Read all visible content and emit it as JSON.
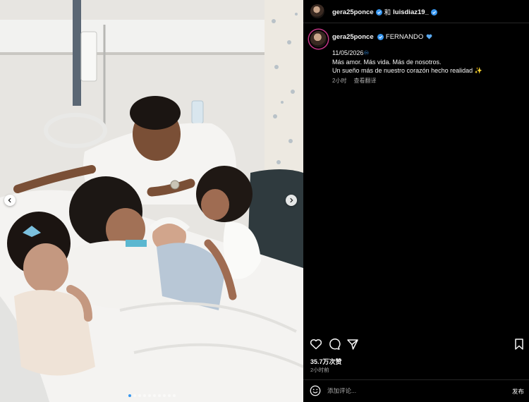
{
  "header": {
    "username": "gera25ponce",
    "connector": "和",
    "collaborator": "luisdiaz19_"
  },
  "caption": {
    "username": "gera25ponce",
    "name": "FERNANDO",
    "date": "11/05/2026",
    "line1": "Más amor. Más vida. Más de nosotros.",
    "line2": "Un sueño más de nuestro corazón hecho realidad",
    "time": "2小时",
    "translate": "查看翻译"
  },
  "post": {
    "likes": "35.7万次赞",
    "time": "2小时前"
  },
  "comment": {
    "placeholder": "添加评论...",
    "post_label": "发布"
  },
  "carousel": {
    "slides": 10,
    "active": 1
  },
  "colors": {
    "verified": "#3897f0",
    "heart": "#5aa9f0",
    "background": "#000000"
  },
  "icons": [
    "chevron-left-icon",
    "chevron-right-icon",
    "heart-icon",
    "comment-icon",
    "share-icon",
    "bookmark-icon",
    "emoji-icon",
    "verified-icon"
  ]
}
